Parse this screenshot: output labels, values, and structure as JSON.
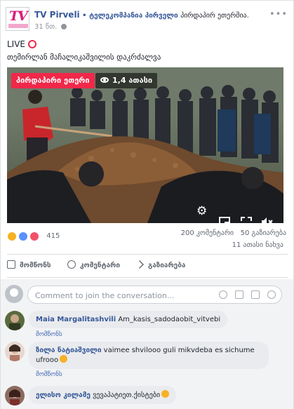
{
  "post": {
    "page_name": "TV Pirveli",
    "separator": "•",
    "with_text": "ტელეკომპანია პირველი",
    "action_text": "პირდაპირ ეთერშია.",
    "timestamp": "31 წთ.",
    "live_label": "LIVE",
    "caption": "თემირლან მაჩალიკაშვილის დაკრძალვა",
    "avatar_logo_text": "TV"
  },
  "video": {
    "live_badge": "პირდაპირი ეთერი",
    "viewers": "1,4 ათასი",
    "controls": {
      "settings_icon": "gear-icon",
      "pip_icon": "picture-in-picture-icon",
      "fullscreen_icon": "fullscreen-icon",
      "mute_icon": "muted-speaker-icon"
    }
  },
  "engagement": {
    "reaction_count": "415",
    "comments_count": "200 კომენტარი",
    "shares_count": "50 გაზიარება",
    "views": "11 ათასი ნახვა"
  },
  "actions": {
    "like_label": "მომწონს",
    "comment_label": "კომენტარი",
    "share_label": "გაზიარება"
  },
  "composer": {
    "placeholder": "Comment to join the conversation..."
  },
  "comments": [
    {
      "author": "Maia Margalitashvili",
      "text": "Am_kasis_sadodaobit_vitvebi",
      "like_label": "მომწონს"
    },
    {
      "author": "ზილა ნატიაშვილი",
      "text": "vaimee shvilooo guli mikvdeba es sichume ufrooo",
      "like_label": "მომწონს"
    },
    {
      "author": "ელისო კილამე",
      "text": "ვევაპატიეთ.ქისტები",
      "like_label": ""
    }
  ],
  "colors": {
    "link": "#365899",
    "live_red": "#f02849",
    "brand_pink": "#d91b7c"
  }
}
